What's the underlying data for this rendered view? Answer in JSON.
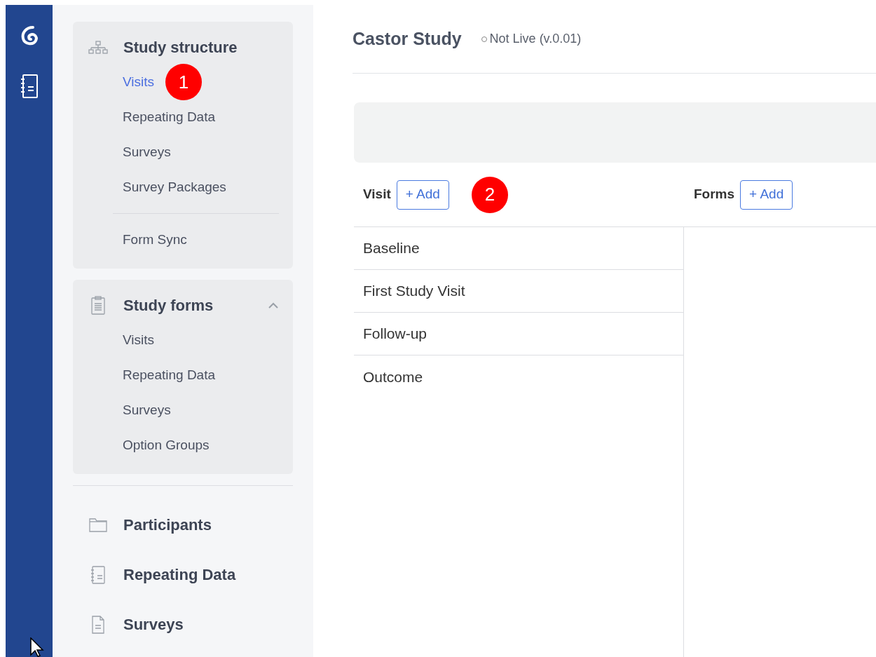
{
  "sidebar": {
    "sections": [
      {
        "title": "Study structure",
        "items": [
          {
            "label": "Visits",
            "selected": true,
            "marker": "1"
          },
          {
            "label": "Repeating Data",
            "selected": false
          },
          {
            "label": "Surveys",
            "selected": false
          },
          {
            "label": "Survey Packages",
            "selected": false
          },
          {
            "label": "Form Sync",
            "selected": false,
            "separated": true
          }
        ]
      },
      {
        "title": "Study forms",
        "expanded": true,
        "items": [
          {
            "label": "Visits",
            "selected": false
          },
          {
            "label": "Repeating Data",
            "selected": false
          },
          {
            "label": "Surveys",
            "selected": false
          },
          {
            "label": "Option Groups",
            "selected": false
          }
        ]
      }
    ],
    "links": [
      {
        "label": "Participants"
      },
      {
        "label": "Repeating Data"
      },
      {
        "label": "Surveys"
      }
    ]
  },
  "header": {
    "title": "Castor Study",
    "status": "Not Live (v.0.01)"
  },
  "visits": {
    "label": "Visit",
    "add_button": "+ Add",
    "marker": "2",
    "rows": [
      "Baseline",
      "First Study Visit",
      "Follow-up",
      "Outcome"
    ]
  },
  "forms": {
    "label": "Forms",
    "add_button": "+ Add"
  }
}
